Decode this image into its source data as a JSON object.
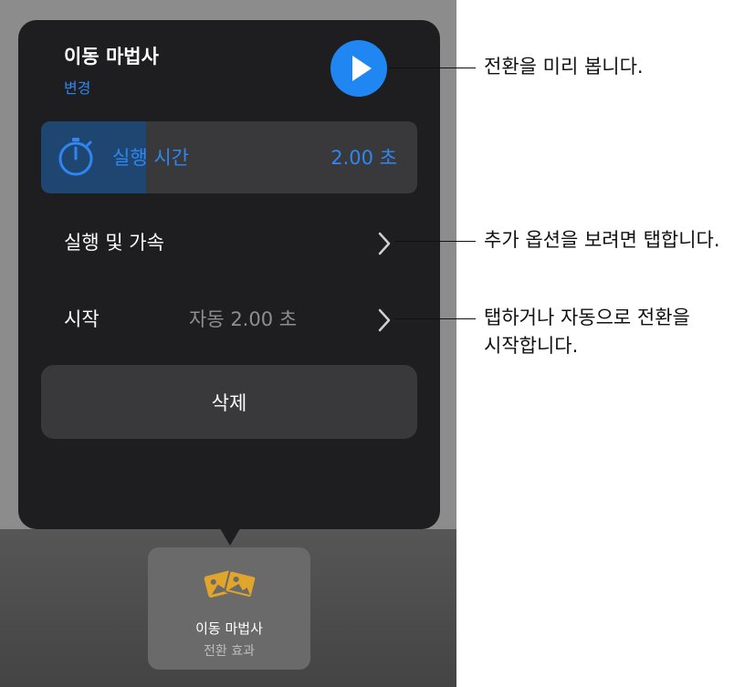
{
  "popover": {
    "title": "이동 마법사",
    "subtitle": "변경",
    "play_icon": "play-icon",
    "duration": {
      "label": "실행 시간",
      "value": "2.00 초",
      "slider_fraction": 0.28,
      "icon": "timer-icon"
    },
    "rows": [
      {
        "label": "실행 및 가속",
        "value": ""
      },
      {
        "label": "시작",
        "value": "자동  2.00 초"
      }
    ],
    "delete_label": "삭제"
  },
  "tile": {
    "icon": "transition-photos-icon",
    "name": "이동 마법사",
    "subtitle": "전환 효과"
  },
  "callouts": {
    "preview": "전환을 미리 봅니다.",
    "options": "추가 옵션을 보려면 탭합니다.",
    "start_line1": "탭하거나 자동으로 전환을",
    "start_line2": "시작합니다."
  },
  "colors": {
    "accent": "#1f86f2",
    "popover_bg": "#1e1e20",
    "control_bg": "#39393c",
    "tile_icon": "#e0a52a"
  }
}
